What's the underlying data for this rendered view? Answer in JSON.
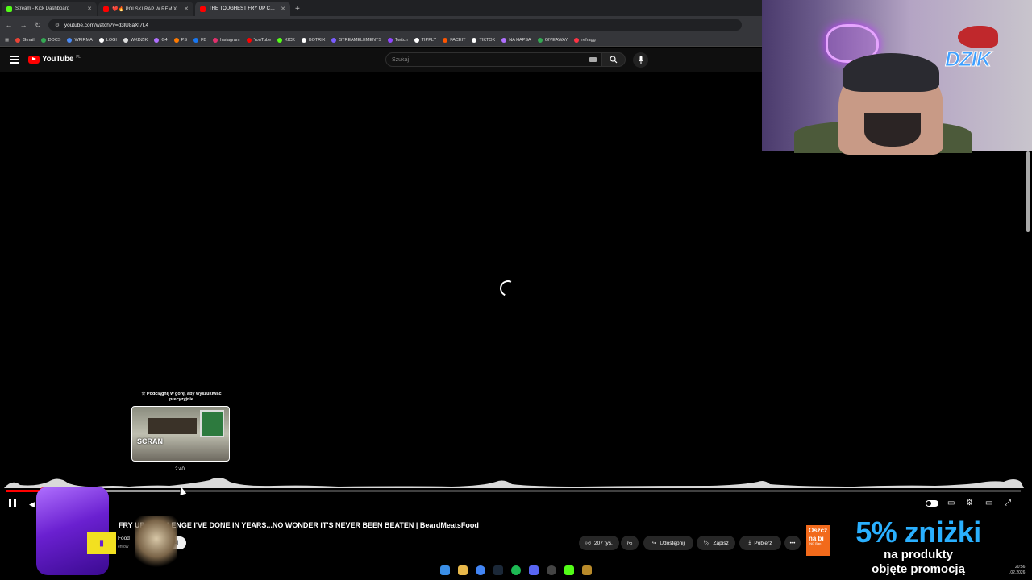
{
  "browser": {
    "tabs": [
      {
        "title": "Stream - Kick Dashboard",
        "favicon_color": "#53fc18",
        "active": false
      },
      {
        "title": "❤️🔥 POLSKI RAP W REMIX",
        "favicon_color": "#ff0000",
        "active": false
      },
      {
        "title": "THE TOUGHEST FRY UP CHALL",
        "favicon_color": "#ff0000",
        "active": true
      }
    ],
    "new_tab": "+",
    "url": "youtube.com/watch?v=d3lU8aXt7L4",
    "bookmarks": [
      {
        "label": "Gmail",
        "color": "#ea4335"
      },
      {
        "label": "DOCS",
        "color": "#34a853"
      },
      {
        "label": "WFIRMA",
        "color": "#4a8af4"
      },
      {
        "label": "LOGI",
        "color": "#ffffff"
      },
      {
        "label": "WKDZIK",
        "color": "#dddddd"
      },
      {
        "label": "G4",
        "color": "#b070ff"
      },
      {
        "label": "PS",
        "color": "#ff7a00"
      },
      {
        "label": "FB",
        "color": "#1877f2"
      },
      {
        "label": "Instagram",
        "color": "#e1306c"
      },
      {
        "label": "YouTube",
        "color": "#ff0000"
      },
      {
        "label": "KICK",
        "color": "#53fc18"
      },
      {
        "label": "BOTRIX",
        "color": "#ffffff"
      },
      {
        "label": "STREAMELEMENTS",
        "color": "#7a5cff"
      },
      {
        "label": "Twitch",
        "color": "#9146ff"
      },
      {
        "label": "TIPPLY",
        "color": "#ffffff"
      },
      {
        "label": "FACEIT",
        "color": "#ff5500"
      },
      {
        "label": "TIKTOK",
        "color": "#ffffff"
      },
      {
        "label": "NA HAPSA",
        "color": "#b070ff"
      },
      {
        "label": "GIVEAWAY",
        "color": "#34a853"
      },
      {
        "label": "refragg",
        "color": "#ff3344"
      }
    ]
  },
  "youtube": {
    "logo": "YouTube",
    "region": "PL",
    "search_placeholder": "Szukaj"
  },
  "player": {
    "hint": "☆ Podciągnij w górę, aby wyszukiwać precyzyjnie",
    "preview_overlay_text": "SCRAN",
    "preview_time": "2:40",
    "progress_played_fraction": 0.036,
    "progress_buffered_fraction": 0.171
  },
  "video": {
    "title": "FRY UP... HALLENGE I'VE DONE IN YEARS...NO WONDER IT'S NEVER BEEN BEATEN | BeardMeatsFood",
    "channel": "Food",
    "subscribers": "entów",
    "subscribe_label": "buj",
    "like_label": "207 tys.",
    "share_label": "Udostępnij",
    "save_label": "Zapisz",
    "download_label": "Pobierz"
  },
  "overlay": {
    "ad_text": "Oszcz na bi",
    "ad_small": "ING Ban",
    "promo_line1": "5% zniżki",
    "promo_line2": "na produkty",
    "promo_line3": "objęte promocją",
    "logo_text": "DZIK"
  },
  "taskbar": {
    "time": "20:56",
    "date": ".02.2026"
  }
}
